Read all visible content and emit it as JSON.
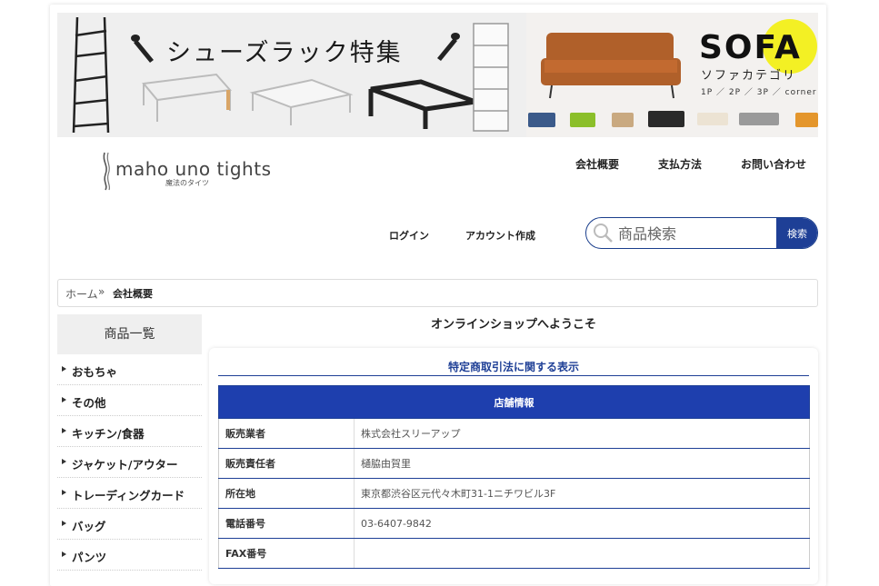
{
  "banners": {
    "shoe": {
      "title": "シューズラック特集"
    },
    "sofa": {
      "title": "SOFA",
      "subtitle": "ソファカテゴリ",
      "types": "1P ／ 2P ／ 3P ／ corner"
    }
  },
  "logo": {
    "name": "maho uno tights",
    "sub": "魔法のタイツ"
  },
  "header": {
    "nav": [
      "会社概要",
      "支払方法",
      "お問い合わせ"
    ],
    "account": [
      "ログイン",
      "アカウント作成"
    ]
  },
  "search": {
    "placeholder": "商品検索",
    "button": "検索"
  },
  "breadcrumb": {
    "home": "ホーム",
    "sep": "»",
    "current": "会社概要"
  },
  "sidebar": {
    "title": "商品一覧",
    "items": [
      "おもちゃ",
      "その他",
      "キッチン/食器",
      "ジャケット/アウター",
      "トレーディングカード",
      "バッグ",
      "パンツ"
    ]
  },
  "main": {
    "welcome": "オンラインショップへようこそ",
    "section_title": "特定商取引法に関する表示",
    "table_head": "店舗情報",
    "rows": [
      {
        "k": "販売業者",
        "v": "株式会社スリーアップ"
      },
      {
        "k": "販売責任者",
        "v": "樋脇由賀里"
      },
      {
        "k": "所在地",
        "v": "東京都渋谷区元代々木町31-1ニチワビル3F"
      },
      {
        "k": "電話番号",
        "v": "03-6407-9842"
      },
      {
        "k": "FAX番号",
        "v": ""
      }
    ]
  },
  "colors": {
    "accent": "#1e3f96",
    "table_head": "#1e3fae",
    "sidebar_head": "#efefef",
    "highlight": "#f3f024"
  }
}
